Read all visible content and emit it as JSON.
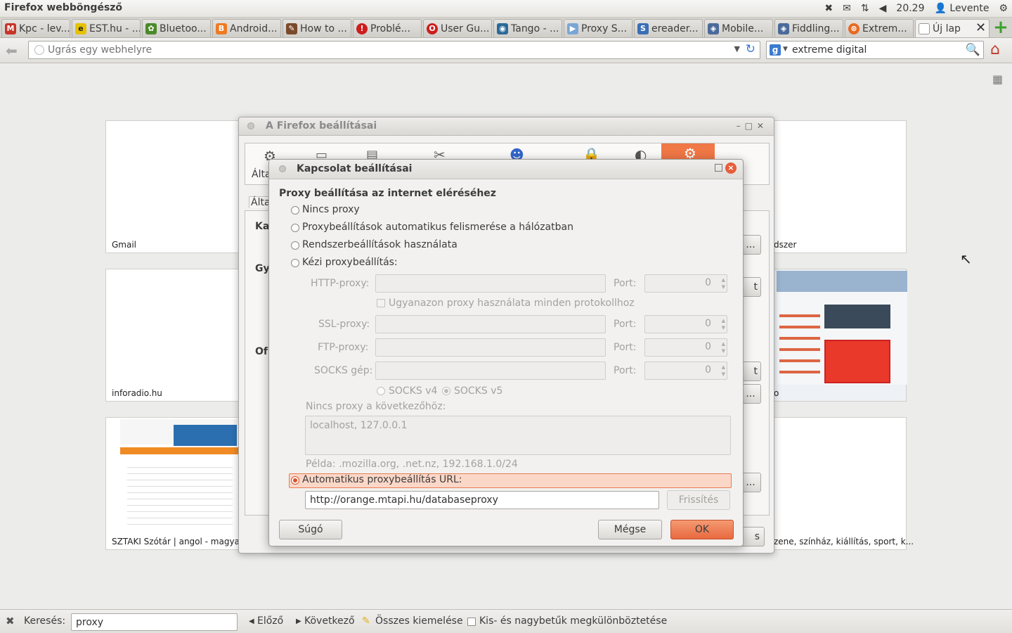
{
  "system": {
    "app_title": "Firefox webböngésző",
    "clock": "20.29",
    "user": "Levente"
  },
  "tabs": [
    {
      "label": "Kpc - lev...",
      "icon_color": "#c73428",
      "glyph": "M"
    },
    {
      "label": "EST.hu - ...",
      "icon_color": "#e6c200",
      "glyph": "e"
    },
    {
      "label": "Bluetoo...",
      "icon_color": "#4a8a2a",
      "glyph": "✿"
    },
    {
      "label": "Android...",
      "icon_color": "#f07a22",
      "glyph": "B"
    },
    {
      "label": "How to ...",
      "icon_color": "#7a4a2a",
      "glyph": "✎"
    },
    {
      "label": "Problé...",
      "icon_color": "#cc1e1e",
      "glyph": "!"
    },
    {
      "label": "User Gu...",
      "icon_color": "#cc1e1e",
      "glyph": "O"
    },
    {
      "label": "Tango - ...",
      "icon_color": "#2a6a9a",
      "glyph": "◉"
    },
    {
      "label": "Proxy S...",
      "icon_color": "#7aa6d6",
      "glyph": "▶"
    },
    {
      "label": "ereader...",
      "icon_color": "#3b6fb6",
      "glyph": "S"
    },
    {
      "label": "Mobile...",
      "icon_color": "#4a6a9a",
      "glyph": "◈"
    },
    {
      "label": "Fiddling...",
      "icon_color": "#4a6a9a",
      "glyph": "◈"
    },
    {
      "label": "Extrem...",
      "icon_color": "#e86a22",
      "glyph": "⊗"
    },
    {
      "label": "Új lap",
      "icon_color": "#ffffff",
      "glyph": ""
    }
  ],
  "nav": {
    "url_placeholder": "Ugrás egy webhelyre",
    "search_value": "extreme digital"
  },
  "tiles": [
    {
      "label": "Gmail"
    },
    {
      "label": "dszer"
    },
    {
      "label": "inforadio.hu"
    },
    {
      "label": "o"
    },
    {
      "label": "SZTAKI Szótár | angol - magyar fo"
    },
    {
      "label": "zene, színház, kiállítás, sport, k..."
    }
  ],
  "prefs_window": {
    "title": "A Firefox beállításai",
    "tab_label_partial": "Álta",
    "panel_tab_partial": "Álta",
    "section_partials": [
      "Ka",
      "Gy",
      "Of"
    ],
    "button_partials": [
      "...",
      "t",
      "t",
      "...",
      "...",
      "s"
    ]
  },
  "dialog": {
    "title": "Kapcsolat beállításai",
    "heading": "Proxy beállítása az internet eléréséhez",
    "options": [
      {
        "label": "Nincs proxy",
        "selected": false
      },
      {
        "label": "Proxybeállítások automatikus felismerése a hálózatban",
        "selected": false
      },
      {
        "label": "Rendszerbeállítások használata",
        "selected": false
      },
      {
        "label": "Kézi proxybeállítás:",
        "selected": false
      }
    ],
    "http_label": "HTTP-proxy:",
    "ssl_label": "SSL-proxy:",
    "ftp_label": "FTP-proxy:",
    "socks_label": "SOCKS gép:",
    "port_label": "Port:",
    "port_values": [
      "0",
      "0",
      "0",
      "0"
    ],
    "same_proxy_label": "Ugyanazon proxy használata minden protokollhoz",
    "socks_v4": "SOCKS v4",
    "socks_v5": "SOCKS v5",
    "no_proxy_label": "Nincs proxy a következőhöz:",
    "no_proxy_value": "localhost, 127.0.0.1",
    "example": "Példa: .mozilla.org, .net.nz, 192.168.1.0/24",
    "auto_label": "Automatikus proxybeállítás URL:",
    "auto_selected": true,
    "auto_url": "http://orange.mtapi.hu/databaseproxy",
    "refresh_button": "Frissítés",
    "help_button": "Súgó",
    "cancel_button": "Mégse",
    "ok_button": "OK"
  },
  "findbar": {
    "label": "Keresés:",
    "value": "proxy",
    "prev": "Előző",
    "next": "Következő",
    "highlight": "Összes kiemelése",
    "match_case": "Kis- és nagybetűk megkülönböztetése"
  },
  "colors": {
    "accent": "#f07746",
    "selected_radio": "#d9532c"
  }
}
